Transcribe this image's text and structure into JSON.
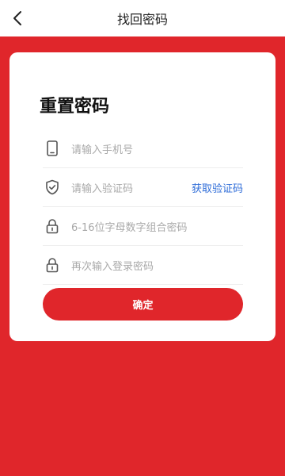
{
  "header": {
    "title": "找回密码",
    "back_icon": "chevron-left-icon"
  },
  "form": {
    "heading": "重置密码",
    "fields": [
      {
        "icon": "phone-icon",
        "placeholder": "请输入手机号"
      },
      {
        "icon": "shield-check-icon",
        "placeholder": "请输入验证码",
        "action": "获取验证码"
      },
      {
        "icon": "lock-icon",
        "placeholder": "6-16位字母数字组合密码"
      },
      {
        "icon": "lock-icon",
        "placeholder": "再次输入登录密码"
      }
    ],
    "submit_label": "确定"
  },
  "colors": {
    "brand_red": "#e0262b",
    "link_blue": "#2f6dd8",
    "placeholder_gray": "#a9a9a9"
  }
}
